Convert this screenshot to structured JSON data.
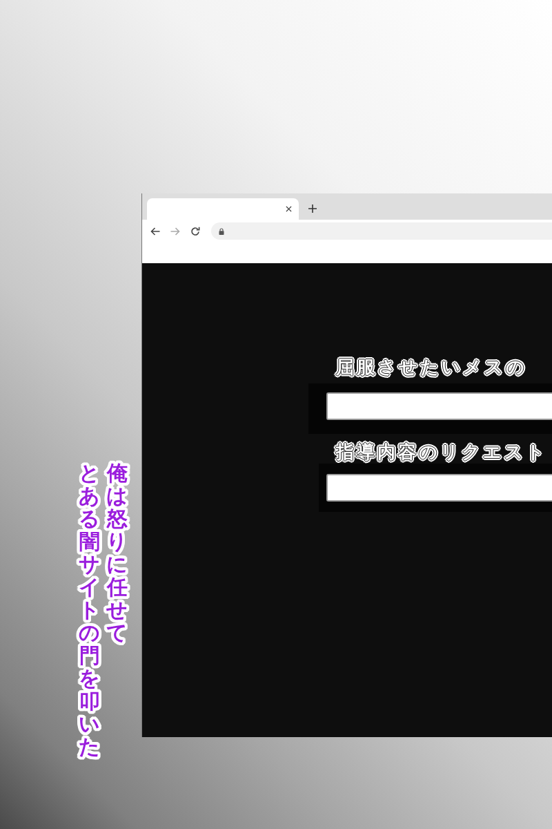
{
  "browser": {
    "tabs": [
      {
        "selected": true
      }
    ],
    "nav_buttons": [
      {
        "kind": "back",
        "disabled": false
      },
      {
        "kind": "forward",
        "disabled": true
      },
      {
        "kind": "reload",
        "disabled": false
      }
    ],
    "address_bar": {
      "secure": true
    }
  },
  "form": {
    "fields": [
      {
        "label": "屈服させたいメスの"
      },
      {
        "label": "指導内容のリクエスト"
      }
    ]
  },
  "caption": {
    "text": "俺は怒りに任せてとある闇サイトの門を叩いた"
  }
}
